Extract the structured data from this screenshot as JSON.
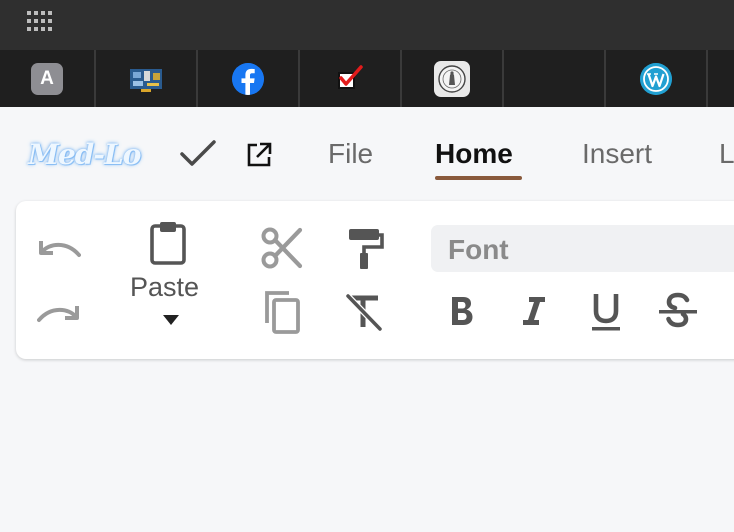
{
  "dock": {
    "app_a_letter": "A"
  },
  "header": {
    "logo_text": "Med-Lo",
    "menu": [
      {
        "label": "File"
      },
      {
        "label": "Home"
      },
      {
        "label": "Insert"
      },
      {
        "label": "L"
      }
    ],
    "active_menu": "Home"
  },
  "ribbon": {
    "paste_label": "Paste",
    "font_placeholder": "Font",
    "icons": [
      "undo-icon",
      "redo-icon",
      "clipboard-icon",
      "caret-down-icon",
      "scissors-icon",
      "copy-icon",
      "paint-roller-icon",
      "clear-format-icon",
      "bold-icon",
      "italic-icon",
      "underline-icon",
      "strikethrough-icon"
    ]
  },
  "colors": {
    "topbar": "#2f2f2f",
    "dock": "#1f1f1f",
    "active_underline": "#8a5a3c",
    "page_bg": "#f6f7f9",
    "icon_gray": "#555555",
    "icon_light": "#9a9a9a"
  }
}
